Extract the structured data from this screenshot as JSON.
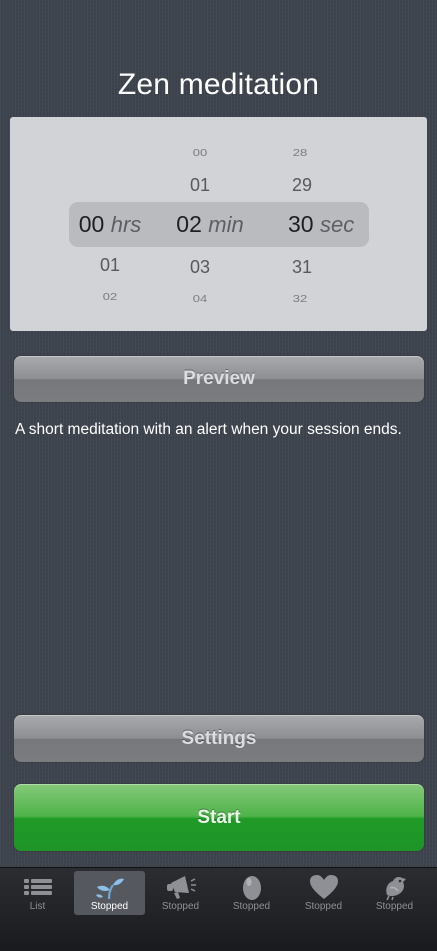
{
  "title": "Zen meditation",
  "picker": {
    "hours": {
      "items_above": [
        "",
        ""
      ],
      "selected": "00",
      "unit": "hrs",
      "items_below": [
        "01",
        "02"
      ]
    },
    "minutes": {
      "items_above": [
        "00",
        "01"
      ],
      "selected": "02",
      "unit": "min",
      "items_below": [
        "03",
        "04"
      ]
    },
    "seconds": {
      "items_above": [
        "28",
        "29"
      ],
      "selected": "30",
      "unit": "sec",
      "items_below": [
        "31",
        "32"
      ]
    }
  },
  "buttons": {
    "preview": "Preview",
    "settings": "Settings",
    "start": "Start"
  },
  "description": "A short meditation with an alert when your session ends.",
  "tabs": [
    {
      "label": "List",
      "icon": "list-icon"
    },
    {
      "label": "Stopped",
      "icon": "sprout-icon",
      "active": true
    },
    {
      "label": "Stopped",
      "icon": "megaphone-icon"
    },
    {
      "label": "Stopped",
      "icon": "egg-icon"
    },
    {
      "label": "Stopped",
      "icon": "heart-icon"
    },
    {
      "label": "Stopped",
      "icon": "bird-icon"
    }
  ],
  "colors": {
    "background": "#3d434d",
    "picker_bg": "#d1d3d6",
    "start_green": "#1f9a27",
    "button_gray": "#8c8e91"
  }
}
